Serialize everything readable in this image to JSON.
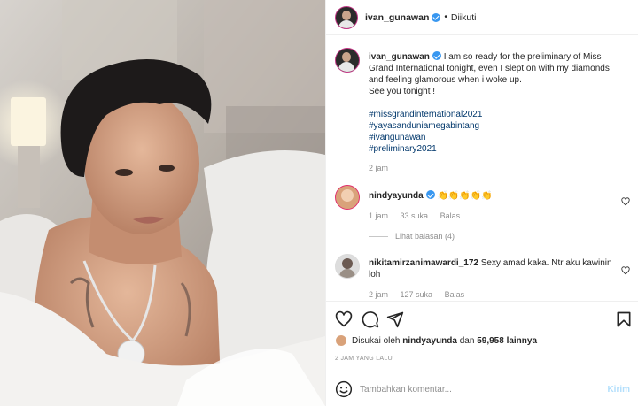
{
  "header": {
    "username": "ivan_gunawan",
    "separator": "•",
    "follow_status": "Diikuti"
  },
  "caption": {
    "username": "ivan_gunawan",
    "text": "I am so ready for the preliminary of Miss Grand International tonight, even I slept on with my diamonds and feeling glamorous when i woke up.",
    "line2": "See you tonight !",
    "hashtags": [
      "#missgrandinternational2021",
      "#yayasanduniamegabintang",
      "#ivangunawan",
      "#preliminary2021"
    ],
    "time": "2 jam"
  },
  "comments": [
    {
      "username": "nindyayunda",
      "text": "👏👏👏👏👏",
      "time": "1 jam",
      "likes": "33 suka",
      "reply": "Balas",
      "view_replies": "Lihat balasan (4)"
    },
    {
      "username": "nikitamirzanimawardi_172",
      "text": "Sexy amad kaka. Ntr aku kawinin loh",
      "time": "2 jam",
      "likes": "127 suka",
      "reply": "Balas"
    }
  ],
  "likes": {
    "prefix": "Disukai oleh",
    "user": "nindyayunda",
    "conj": "dan",
    "others": "59,958 lainnya"
  },
  "timeago": "2 JAM YANG LALU",
  "add_comment": {
    "placeholder": "Tambahkan komentar...",
    "send_label": "Kirim"
  },
  "icons": {
    "heart": "heart-icon",
    "comment": "comment-icon",
    "share": "share-icon",
    "save": "bookmark-icon",
    "emoji": "emoji-icon"
  },
  "colors": {
    "hashtag": "#00376b",
    "verified": "#3897f0",
    "muted": "#8e8e8e",
    "send_disabled": "#b2dffc"
  }
}
